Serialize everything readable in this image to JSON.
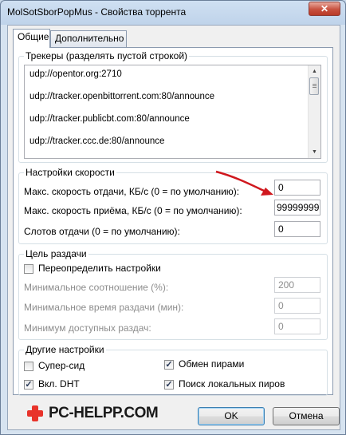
{
  "window": {
    "title": "MolSotSborPopMus - Свойства торрента",
    "close_glyph": "✕"
  },
  "tabs": [
    {
      "label": "Общие",
      "active": true
    },
    {
      "label": "Дополнительно",
      "active": false
    }
  ],
  "trackers": {
    "legend": "Трекеры (разделять пустой строкой)",
    "items": [
      "udp://opentor.org:2710",
      "udp://tracker.openbittorrent.com:80/announce",
      "udp://tracker.publicbt.com:80/announce",
      "udp://tracker.ccc.de:80/announce"
    ]
  },
  "speed": {
    "legend": "Настройки скорости",
    "upload_label": "Макс. скорость отдачи, КБ/с (0 = по умолчанию):",
    "upload_value": "0",
    "download_label": "Макс. скорость приёма, КБ/с (0 = по умолчанию):",
    "download_value": "999999999",
    "slots_label": "Слотов отдачи (0 = по умолчанию):",
    "slots_value": "0"
  },
  "seeding": {
    "legend": "Цель раздачи",
    "override_label": "Переопределить настройки",
    "override_checked": false,
    "min_ratio_label": "Минимальное соотношение (%):",
    "min_ratio_value": "200",
    "min_time_label": "Минимальное время раздачи (мин):",
    "min_time_value": "0",
    "min_seeds_label": "Минимум доступных раздач:",
    "min_seeds_value": "0"
  },
  "other": {
    "legend": "Другие настройки",
    "superseed_label": "Супер-сид",
    "superseed_checked": false,
    "peer_exchange_label": "Обмен пирами",
    "peer_exchange_checked": true,
    "dht_label": "Вкл. DHT",
    "dht_checked": true,
    "local_peers_label": "Поиск локальных пиров",
    "local_peers_checked": true
  },
  "watermark": {
    "text": "PC-HELPP.COM",
    "icon": "red-cross-icon",
    "color": "#e8332a"
  },
  "buttons": {
    "ok": "OK",
    "cancel": "Отмена"
  },
  "annotation": {
    "icon": "red-arrow-icon",
    "color": "#d0181e"
  }
}
